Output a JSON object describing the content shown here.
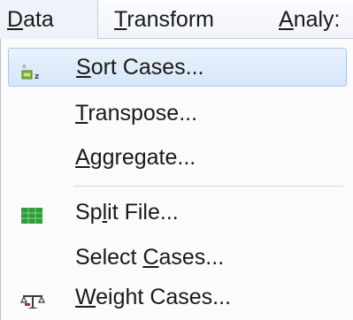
{
  "menubar": {
    "items": [
      {
        "pre": "",
        "key": "D",
        "post": "ata"
      },
      {
        "pre": "",
        "key": "T",
        "post": "ransform"
      },
      {
        "pre": "",
        "key": "A",
        "post": "naly:"
      }
    ]
  },
  "dropdown": {
    "items": [
      {
        "pre": "",
        "key": "S",
        "post": "ort Cases...",
        "icon": "sort-cases-icon",
        "highlighted": true
      },
      {
        "pre": "",
        "key": "T",
        "post": "ranspose...",
        "icon": null
      },
      {
        "pre": "",
        "key": "A",
        "post": "ggregate...",
        "icon": null
      },
      {
        "pre": "Sp",
        "key": "l",
        "post": "it File...",
        "icon": "split-file-icon"
      },
      {
        "pre": "Select ",
        "key": "C",
        "post": "ases...",
        "icon": null
      },
      {
        "pre": "",
        "key": "W",
        "post": "eight Cases...",
        "icon": "weight-cases-icon"
      }
    ]
  },
  "colors": {
    "highlight": "#d6e6f8",
    "highlight_border": "#a9c8ea",
    "split_icon_green": "#2e9e3a"
  }
}
